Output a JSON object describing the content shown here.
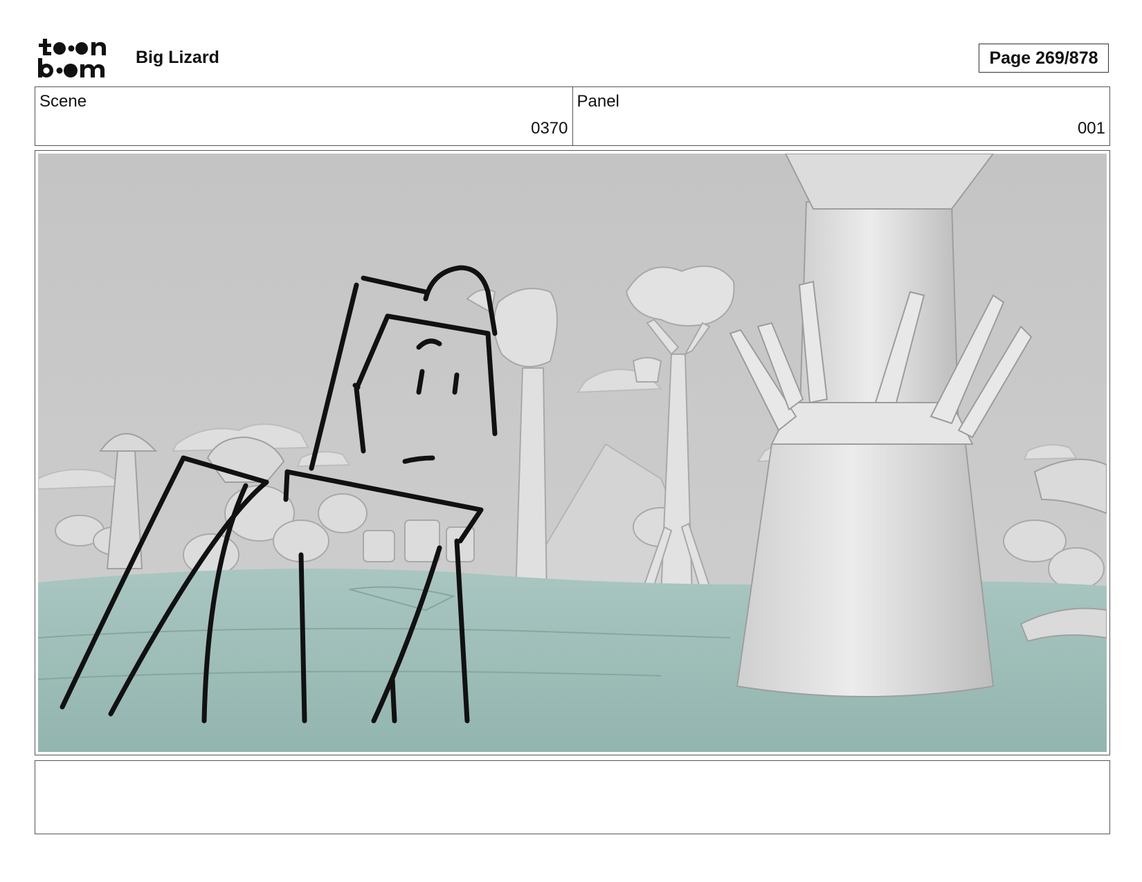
{
  "header": {
    "logo_text_top": "toon",
    "logo_text_bottom": "boom",
    "project_title": "Big Lizard",
    "page_counter": "Page 269/878"
  },
  "info": {
    "scene_label": "Scene",
    "scene_value": "0370",
    "panel_label": "Panel",
    "panel_value": "001"
  },
  "panel": {
    "description": "",
    "colors": {
      "sky": "#c9c9c9",
      "ground": "#9fbfba",
      "props": "#e2e2e2",
      "ink": "#111111"
    }
  },
  "notes": {
    "text": ""
  }
}
